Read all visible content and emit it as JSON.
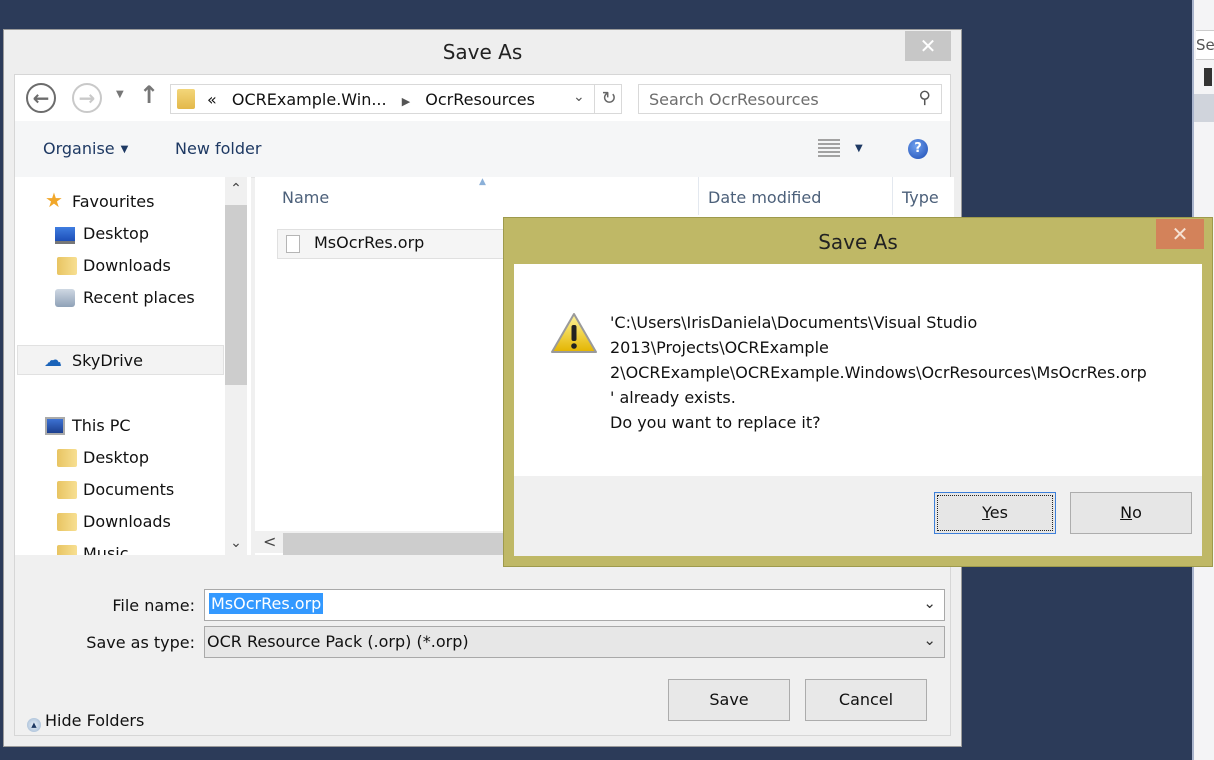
{
  "background_window": {
    "search_fragment": "Se"
  },
  "save_dialog": {
    "title": "Save As",
    "close_glyph": "✕",
    "nav": {
      "back_glyph": "←",
      "forward_glyph": "→",
      "recent_glyph": "▼",
      "up_glyph": "↑",
      "breadcrumb_overflow": "«",
      "breadcrumb": [
        "OCRExample.Win...",
        "OcrResources"
      ],
      "breadcrumb_separator": "▶",
      "address_dropdown_glyph": "⌄",
      "refresh_glyph": "↻",
      "search_placeholder": "Search OcrResources",
      "search_glyph": "⚲"
    },
    "toolbar": {
      "organise_label": "Organise",
      "organise_caret": "▼",
      "new_folder_label": "New folder",
      "view_caret": "▼",
      "help_glyph": "?"
    },
    "sidebar": {
      "scroll_up_glyph": "⌃",
      "scroll_down_glyph": "⌄",
      "items": [
        {
          "label": "Favourites",
          "icon": "star-icon"
        },
        {
          "label": "Desktop",
          "icon": "desktop-icon"
        },
        {
          "label": "Downloads",
          "icon": "downloads-folder-icon"
        },
        {
          "label": "Recent places",
          "icon": "recent-places-icon"
        },
        {
          "label": "SkyDrive",
          "icon": "skydrive-icon",
          "selected": true
        },
        {
          "label": "This PC",
          "icon": "computer-icon"
        },
        {
          "label": "Desktop",
          "icon": "desktop-folder-icon"
        },
        {
          "label": "Documents",
          "icon": "documents-folder-icon"
        },
        {
          "label": "Downloads",
          "icon": "downloads-folder-icon"
        },
        {
          "label": "Music",
          "icon": "music-folder-icon"
        }
      ]
    },
    "file_list": {
      "columns": [
        "Name",
        "Date modified",
        "Type"
      ],
      "sort_glyph": "▲",
      "files": [
        {
          "name": "MsOcrRes.orp"
        }
      ],
      "hscroll_left_glyph": "<"
    },
    "file_name_label": "File name:",
    "file_name_value": "MsOcrRes.orp",
    "save_as_type_label": "Save as type:",
    "save_as_type_value": "OCR Resource Pack (.orp) (*.orp)",
    "dropdown_glyph": "⌄",
    "hide_folders_label": "Hide Folders",
    "hide_folders_glyph": "▲",
    "save_label": "Save",
    "cancel_label": "Cancel"
  },
  "confirm_dialog": {
    "title": "Save As",
    "close_glyph": "✕",
    "message_lines": [
      "'C:\\Users\\IrisDaniela\\Documents\\Visual Studio",
      "2013\\Projects\\OCRExample",
      "2\\OCRExample\\OCRExample.Windows\\OcrResources\\MsOcrRes.orp",
      "' already exists.",
      "Do you want to replace it?"
    ],
    "yes_mnemonic": "Y",
    "yes_rest": "es",
    "no_mnemonic": "N",
    "no_rest": "o",
    "colors": {
      "frame": "#bfb866",
      "close": "#d3825a"
    }
  }
}
